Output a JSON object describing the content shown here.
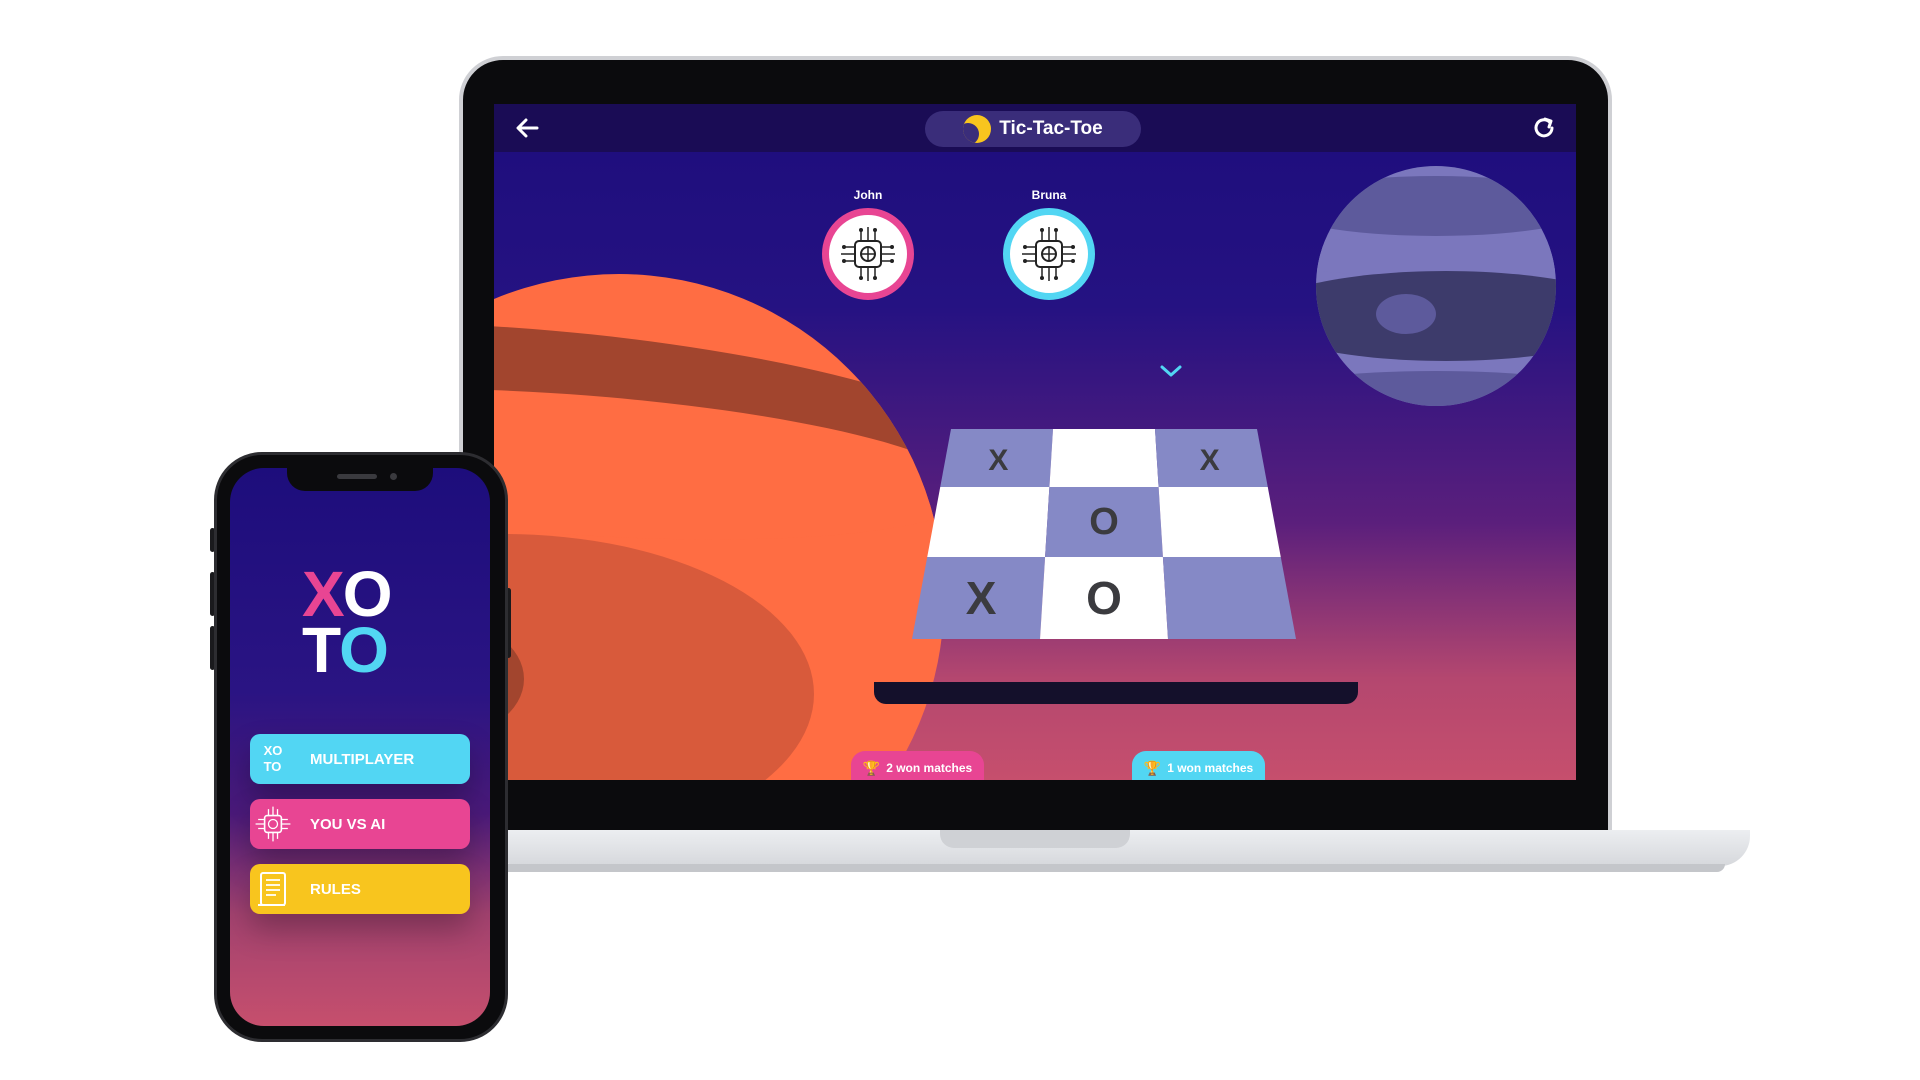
{
  "laptop": {
    "topbar": {
      "title": "Tic-Tac-Toe",
      "back_icon": "arrow-left-icon",
      "refresh_icon": "refresh-icon"
    },
    "players": [
      {
        "name": "John",
        "avatar_icon": "ai-chip-brain-icon",
        "ring_color": "#e84593",
        "won_label": "2 won matches",
        "active": false
      },
      {
        "name": "Bruna",
        "avatar_icon": "ai-chip-brain-icon",
        "ring_color": "#52d6f3",
        "won_label": "1 won matches",
        "active": true
      }
    ],
    "board": [
      [
        "X",
        "",
        "X"
      ],
      [
        "",
        "O",
        ""
      ],
      [
        "X",
        "O",
        ""
      ]
    ],
    "colors": {
      "board_purple": "#8589c6",
      "board_white": "#ffffff",
      "mark": "#3b3b3f",
      "planet_orange": "#ff6d43",
      "planet_purple": "#7b77bd"
    }
  },
  "phone": {
    "logo": {
      "line1": [
        "X",
        "O"
      ],
      "line2": [
        "T",
        "O"
      ]
    },
    "menu": [
      {
        "label": "MULTIPLAYER",
        "color": "#52d6f3",
        "icon_text": [
          "XO",
          "TO"
        ],
        "icon": "xoto-mini-icon"
      },
      {
        "label": "YOU VS AI",
        "color": "#e84593",
        "icon": "ai-chip-brain-icon"
      },
      {
        "label": "RULES",
        "color": "#f8c51e",
        "icon": "rules-scroll-icon"
      }
    ]
  }
}
